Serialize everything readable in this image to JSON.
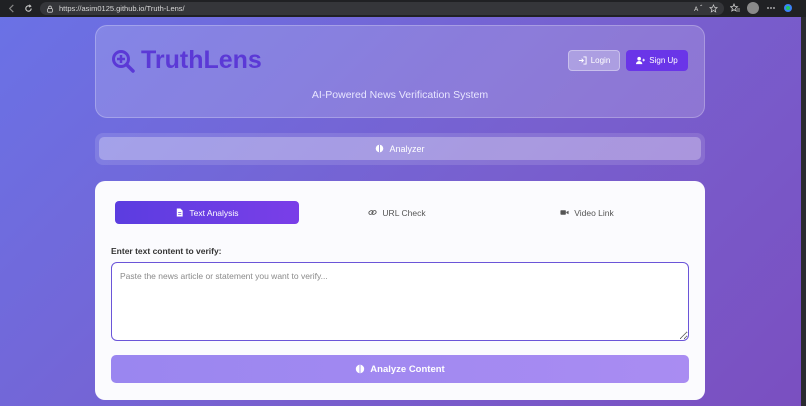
{
  "browser": {
    "url": "https://asim0125.github.io/Truth-Lens/"
  },
  "header": {
    "logo_text": "TruthLens",
    "login_label": "Login",
    "signup_label": "Sign Up",
    "subtitle": "AI-Powered News Verification System"
  },
  "nav": {
    "analyzer_label": "Analyzer"
  },
  "main": {
    "tabs": [
      {
        "label": "Text Analysis",
        "icon": "document-icon",
        "active": true
      },
      {
        "label": "URL Check",
        "icon": "link-icon",
        "active": false
      },
      {
        "label": "Video Link",
        "icon": "video-icon",
        "active": false
      }
    ],
    "field_label": "Enter text content to verify:",
    "textarea_placeholder": "Paste the news article or statement you want to verify...",
    "analyze_label": "Analyze Content"
  },
  "colors": {
    "brand": "#5b39d6",
    "accent": "#6a35e8"
  }
}
